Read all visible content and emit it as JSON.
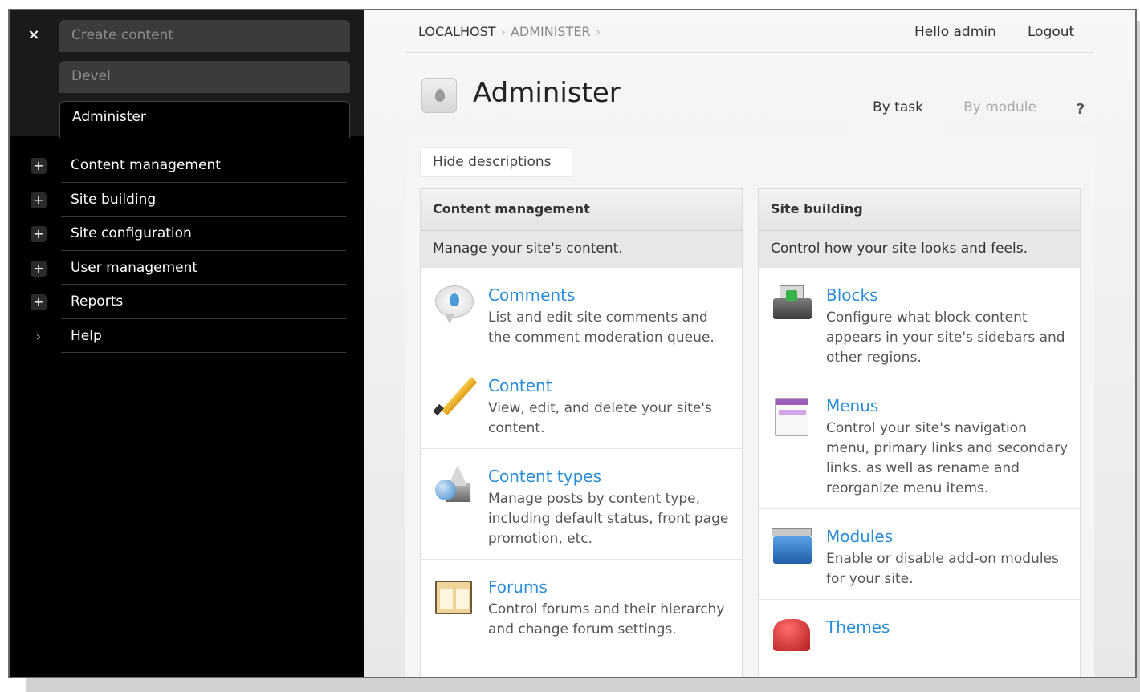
{
  "sidebar": {
    "close_glyph": "×",
    "shortcuts": [
      {
        "label": "Create content"
      },
      {
        "label": "Devel"
      },
      {
        "label": "Administer"
      }
    ],
    "nav": [
      {
        "label": "Content management",
        "toggle": "+"
      },
      {
        "label": "Site building",
        "toggle": "+"
      },
      {
        "label": "Site configuration",
        "toggle": "+"
      },
      {
        "label": "User management",
        "toggle": "+"
      },
      {
        "label": "Reports",
        "toggle": "+"
      },
      {
        "label": "Help",
        "toggle": "›"
      }
    ]
  },
  "header": {
    "breadcrumb": [
      "LOCALHOST",
      "ADMINISTER"
    ],
    "breadcrumb_sep": "›",
    "greeting": "Hello admin",
    "logout": "Logout"
  },
  "page": {
    "title": "Administer",
    "tabs": [
      {
        "label": "By task",
        "active": true
      },
      {
        "label": "By module",
        "active": false
      }
    ],
    "help_glyph": "?",
    "hide_descriptions": "Hide descriptions"
  },
  "sections": {
    "left": {
      "title": "Content management",
      "subtitle": "Manage your site's content.",
      "items": [
        {
          "title": "Comments",
          "desc": "List and edit site comments and the comment moderation queue.",
          "icon": "comments-icon"
        },
        {
          "title": "Content",
          "desc": "View, edit, and delete your site's content.",
          "icon": "pencil-icon"
        },
        {
          "title": "Content types",
          "desc": "Manage posts by content type, including default status, front page promotion, etc.",
          "icon": "shapes-icon"
        },
        {
          "title": "Forums",
          "desc": "Control forums and their hierarchy and change forum settings.",
          "icon": "forum-icon"
        }
      ]
    },
    "right": {
      "title": "Site building",
      "subtitle": "Control how your site looks and feels.",
      "items": [
        {
          "title": "Blocks",
          "desc": "Configure what block content appears in your site's sidebars and other regions.",
          "icon": "blocks-icon"
        },
        {
          "title": "Menus",
          "desc": "Control your site's navigation menu, primary links and secondary links. as well as rename and reorganize menu items.",
          "icon": "menus-icon"
        },
        {
          "title": "Modules",
          "desc": "Enable or disable add-on modules for your site.",
          "icon": "modules-icon"
        },
        {
          "title": "Themes",
          "desc": "",
          "icon": "themes-icon"
        }
      ]
    }
  },
  "colors": {
    "link": "#2b8dd6",
    "sidebar_bg": "#000000",
    "main_bg": "#f0f0f0"
  }
}
